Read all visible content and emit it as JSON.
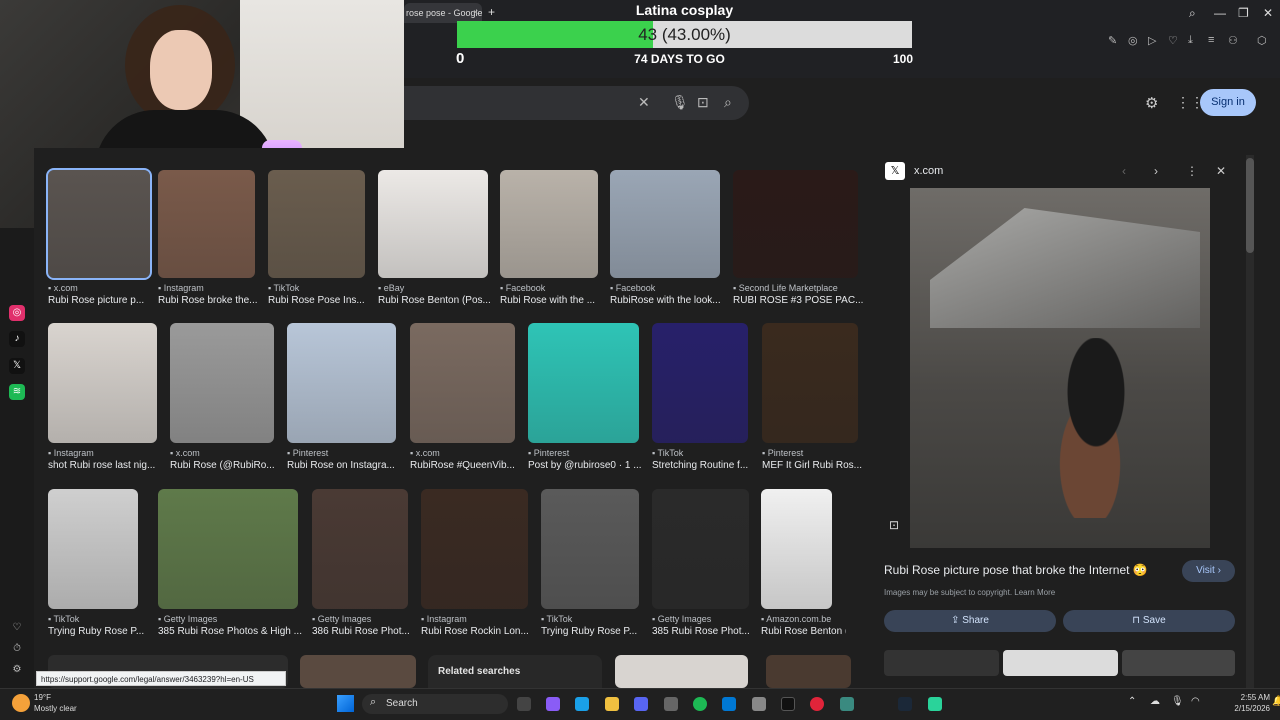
{
  "overlay": {
    "title": "Latina cosplay",
    "progress_text": "43 (43.00%)",
    "progress_fraction": 0.43,
    "min": "0",
    "days": "74 DAYS TO GO",
    "max": "100"
  },
  "browser": {
    "tab_title": "rose pose - Google S",
    "tab_close": "×",
    "tab_add": "+",
    "win_min": "—",
    "win_max": "❐",
    "win_close": "✕"
  },
  "google": {
    "search_clear": "✕",
    "sign_in": "Sign in",
    "related_searches": "Related searches"
  },
  "row1": [
    {
      "src": "x.com",
      "cap": "Rubi Rose picture p...",
      "color": "#5a5450",
      "sel": true
    },
    {
      "src": "Instagram",
      "cap": "Rubi Rose broke the...",
      "color": "#7a5a4a"
    },
    {
      "src": "TikTok",
      "cap": "Rubi Rose Pose Ins...",
      "color": "#6a5d4e"
    },
    {
      "src": "eBay",
      "cap": "Rubi Rose Benton (Pos...",
      "color": "#ece9e6"
    },
    {
      "src": "Facebook",
      "cap": "Rubi Rose with the ...",
      "color": "#b9b2a9"
    },
    {
      "src": "Facebook",
      "cap": "RubiRose with the look...",
      "color": "#9aa6b5"
    },
    {
      "src": "Second Life Marketplace",
      "cap": "RUBI ROSE #3 POSE PAC...",
      "color": "#2a1a18"
    }
  ],
  "row2": [
    {
      "src": "Instagram",
      "cap": "shot Rubi rose last nig...",
      "color": "#d9d4cf"
    },
    {
      "src": "x.com",
      "cap": "Rubi Rose (@RubiRo...",
      "color": "#9a9a9a"
    },
    {
      "src": "Pinterest",
      "cap": "Rubi Rose on Instagra...",
      "color": "#b8c6d8"
    },
    {
      "src": "x.com",
      "cap": "RubiRose #QueenVib...",
      "color": "#7a6a60"
    },
    {
      "src": "Pinterest",
      "cap": "Post by @rubirose0 · 1 ...",
      "color": "#2ec4b6"
    },
    {
      "src": "TikTok",
      "cap": "Stretching Routine f...",
      "color": "#27206a"
    },
    {
      "src": "Pinterest",
      "cap": "MEF It Girl Rubi Ros...",
      "color": "#3a2a1e"
    }
  ],
  "row3": [
    {
      "src": "TikTok",
      "cap": "Trying Ruby Rose P...",
      "color": "#cfcfcf"
    },
    {
      "src": "Getty Images",
      "cap": "385 Rubi Rose Photos & High ...",
      "color": "#5f7a4a"
    },
    {
      "src": "Getty Images",
      "cap": "386 Rubi Rose Phot...",
      "color": "#4a3a34"
    },
    {
      "src": "Instagram",
      "cap": "Rubi Rose Rockin Lon...",
      "color": "#3a2a22"
    },
    {
      "src": "TikTok",
      "cap": "Trying Ruby Rose P...",
      "color": "#5a5a5a"
    },
    {
      "src": "Getty Images",
      "cap": "385 Rubi Rose Phot...",
      "color": "#2a2a2a"
    },
    {
      "src": "Amazon.com.be",
      "cap": "Rubi Rose Benton (...",
      "color": "#f0f0f0"
    }
  ],
  "panel": {
    "source": "x.com",
    "title": "Rubi Rose picture pose that broke the Internet 😳",
    "visit": "Visit ›",
    "copyright": "Images may be subject to copyright. Learn More",
    "share": "Share",
    "save": "Save"
  },
  "status_url": "https://support.google.com/legal/answer/3463239?hl=en-US",
  "taskbar": {
    "weather_temp": "19°F",
    "weather_desc": "Mostly clear",
    "search": "Search",
    "time": "2:55 AM",
    "date": "2/15/2026"
  }
}
